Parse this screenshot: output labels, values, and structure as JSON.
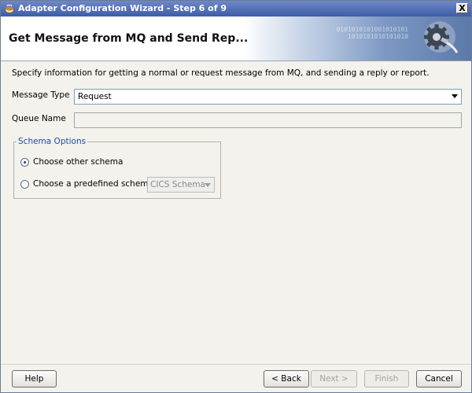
{
  "window": {
    "title": "Adapter Configuration Wizard - Step 6 of 9",
    "close_glyph": "X"
  },
  "banner": {
    "heading": "Get Message from MQ and Send Rep...",
    "bits_line1": "0101010101001010101",
    "bits_line2": "1010101010101010",
    "icon": "gear-plug-icon"
  },
  "instructions": "Specify information for getting a normal or request message from MQ, and sending a reply or report.",
  "form": {
    "message_type_label": "Message Type",
    "message_type_value": "Request",
    "queue_name_label": "Queue Name",
    "queue_name_value": ""
  },
  "schema_options": {
    "legend": "Schema Options",
    "option_other": "Choose other schema",
    "option_predefined": "Choose a predefined schema",
    "selected": "other",
    "predefined_select_value": "CICS Schema"
  },
  "buttons": {
    "help": "Help",
    "back": "< Back",
    "next": "Next >",
    "finish": "Finish",
    "cancel": "Cancel"
  },
  "colors": {
    "titlebar": "#3d5da8",
    "legend": "#1f4aa6",
    "background": "#f3f2ec"
  }
}
